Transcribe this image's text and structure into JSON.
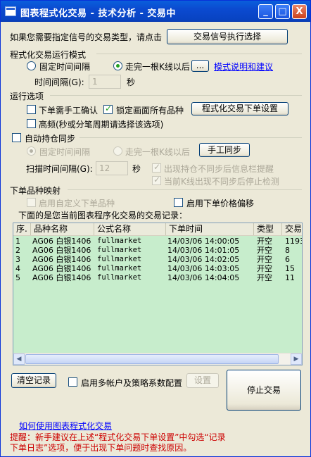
{
  "window": {
    "title": "图表程式化交易 - 技术分析 - 交易中",
    "minimize_glyph": "_",
    "maximize_glyph": "□",
    "close_glyph": "X"
  },
  "top": {
    "prompt": "如果您需要指定信号的交易类型，请点击",
    "signal_button": "交易信号执行选择"
  },
  "mode": {
    "group_label": "程式化交易运行模式",
    "fixed_interval_label": "固定时间间隔",
    "fixed_interval_selected": false,
    "after_bar_label": "走完一根K线以后",
    "after_bar_selected": true,
    "more_button": "...",
    "help_link": "模式说明和建议",
    "interval_label": "时间间隔(G):",
    "interval_value": "1",
    "interval_unit": "秒"
  },
  "options": {
    "group_label": "运行选项",
    "manual_confirm_label": "下单需手工确认",
    "manual_confirm_checked": false,
    "lock_all_label": "锁定画面所有品种",
    "lock_all_checked": true,
    "settings_button": "程式化交易下单设置",
    "hf_label": "高频(秒或分笔周期请选择该选项)",
    "hf_checked": false
  },
  "sync": {
    "auto_sync_label": "自动持仓同步",
    "auto_sync_checked": false,
    "fixed_interval_label": "固定时间间隔",
    "after_bar_label": "走完一根K线以后",
    "manual_sync_button": "手工同步",
    "scan_label": "扫描时间间隔(G):",
    "scan_value": "12",
    "scan_unit": "秒",
    "alert_label": "出现持仓不同步后信息栏提醒",
    "alert_checked": true,
    "stop_label": "当前K线出现不同步后停止检测",
    "stop_checked": true
  },
  "mapping": {
    "group_label": "下单品种映射",
    "custom_label": "启用自定义下单品种",
    "custom_checked": false,
    "offset_label": "启用下单价格偏移",
    "offset_checked": false
  },
  "records": {
    "caption": "下面的是您当前图表程序化交易的交易记录：",
    "columns": [
      "序.",
      "品种名称",
      "公式名称",
      "下单时间",
      "类型",
      "交易"
    ],
    "rows": [
      [
        "1",
        "AG06 白银1406",
        "fullmarket",
        "14/03/06 14:00:05",
        "开空",
        "1193"
      ],
      [
        "2",
        "AG06 白银1406",
        "fullmarket",
        "14/03/06 14:01:05",
        "开空",
        "8"
      ],
      [
        "3",
        "AG06 白银1406",
        "fullmarket",
        "14/03/06 14:02:05",
        "开空",
        "6"
      ],
      [
        "4",
        "AG06 白银1406",
        "fullmarket",
        "14/03/06 14:03:05",
        "开空",
        "15"
      ],
      [
        "5",
        "AG06 白银1406",
        "fullmarket",
        "14/03/06 14:04:05",
        "开空",
        "11"
      ]
    ],
    "scroll_left_glyph": "◀",
    "scroll_right_glyph": "▶"
  },
  "bottom": {
    "clear_button": "清空记录",
    "multi_account_label": "启用多帐户及策略系数配置",
    "multi_account_checked": false,
    "config_button": "设置",
    "stop_button": "停止交易",
    "howto_link": "如何使用图表程式化交易",
    "hint_line1": "提醒：新手建议在上述“程式化交易下单设置”中勾选“记录",
    "hint_line2": "下单日志”选项，便于出现下单问题时查找原因。"
  },
  "colors": {
    "titlebar": "#0b4ad0",
    "table_bg": "#c7edcc",
    "check_mark": "#21a121",
    "hint_text": "#cc0000",
    "link": "#0000ff"
  },
  "icons": [
    "app-icon",
    "minimize-icon",
    "maximize-icon",
    "close-icon",
    "check-icon",
    "radio-dot-icon",
    "scroll-left-icon",
    "scroll-right-icon"
  ]
}
